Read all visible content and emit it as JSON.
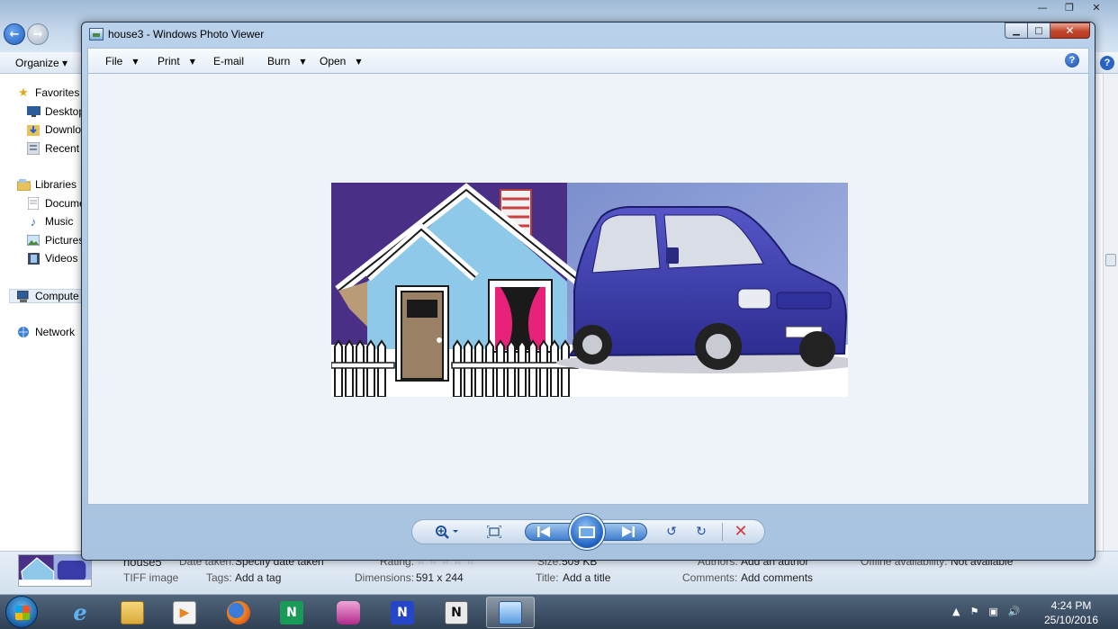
{
  "explorer": {
    "toolbar": {
      "organize_label": "Organize ▾"
    },
    "nav": {
      "favorites": "Favorites",
      "desktop": "Desktop",
      "downloads": "Downlo",
      "recent": "Recent P",
      "libraries": "Libraries",
      "documents": "Docume",
      "music": "Music",
      "pictures": "Pictures",
      "videos": "Videos",
      "computer": "Compute",
      "network": "Network"
    },
    "details": {
      "file_name": "house5",
      "file_type": "TIFF image",
      "date_taken_label": "Date taken:",
      "date_taken_value": "Specify date taken",
      "tags_label": "Tags:",
      "tags_value": "Add a tag",
      "rating_label": "Rating:",
      "dimensions_label": "Dimensions:",
      "dimensions_value": "591 x 244",
      "size_label": "Size:",
      "size_value": "509 KB",
      "title_label": "Title:",
      "title_value": "Add a title",
      "authors_label": "Authors:",
      "authors_value": "Add an author",
      "comments_label": "Comments:",
      "comments_value": "Add comments",
      "offline_label": "Offline availability:",
      "offline_value": "Not available"
    }
  },
  "viewer": {
    "title": "house3 - Windows Photo Viewer",
    "menu": {
      "file": "File",
      "print": "Print",
      "email": "E-mail",
      "burn": "Burn",
      "open": "Open"
    },
    "help_glyph": "?"
  },
  "taskbar": {
    "time": "4:24 PM",
    "date": "25/10/2016"
  },
  "colors": {
    "sky_left": "#4a2f86",
    "sky_right": "#8da2d6",
    "house_blue": "#8ec9ea",
    "car_body": "#3a3aa8",
    "close_red": "#d13a3a"
  }
}
